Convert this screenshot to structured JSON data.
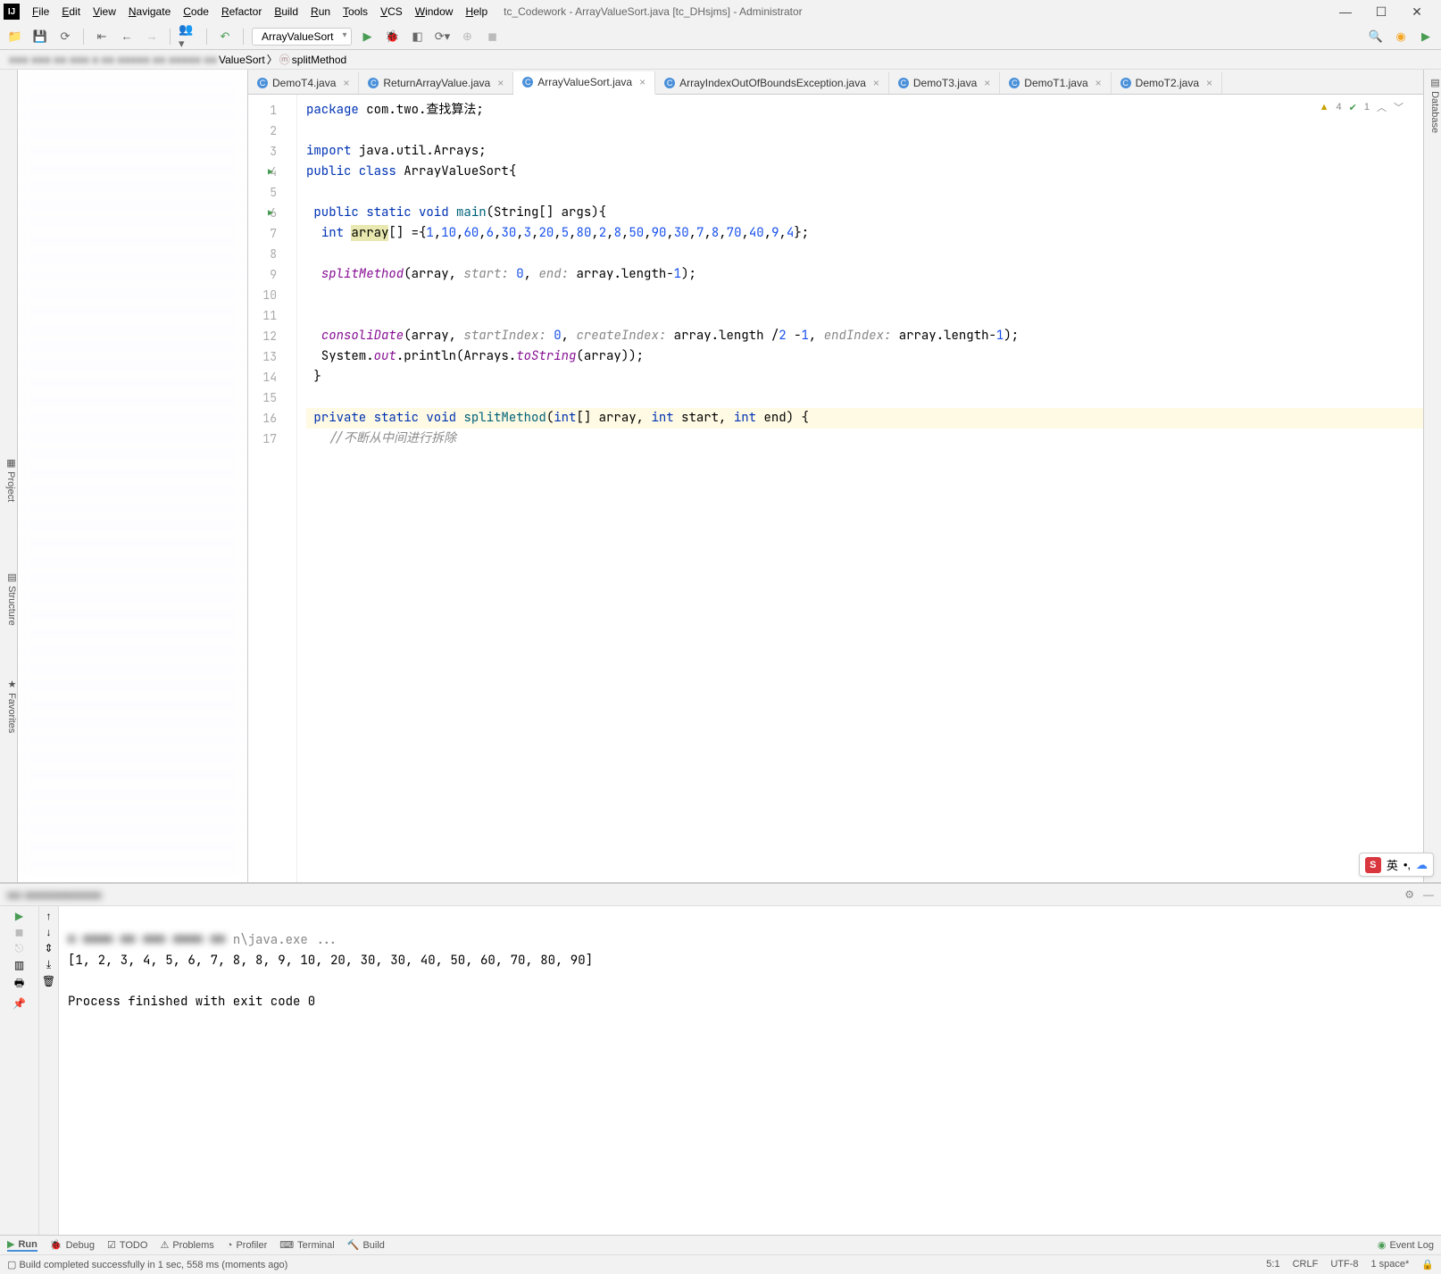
{
  "window_title": "tc_Codework - ArrayValueSort.java [tc_DHsjms] - Administrator",
  "menu": [
    "File",
    "Edit",
    "View",
    "Navigate",
    "Code",
    "Refactor",
    "Build",
    "Run",
    "Tools",
    "VCS",
    "Window",
    "Help"
  ],
  "run_config": "ArrayValueSort",
  "breadcrumb": {
    "tail": "ValueSort",
    "method": "splitMethod",
    "icon": "m"
  },
  "tabs": [
    {
      "label": "DemoT4.java"
    },
    {
      "label": "ReturnArrayValue.java"
    },
    {
      "label": "ArrayValueSort.java",
      "active": true
    },
    {
      "label": "ArrayIndexOutOfBoundsException.java"
    },
    {
      "label": "DemoT3.java"
    },
    {
      "label": "DemoT1.java"
    },
    {
      "label": "DemoT2.java"
    }
  ],
  "inspections": {
    "warn": "4",
    "ok": "1"
  },
  "code_lines": [
    {
      "n": 1,
      "html": "<span class='kw'>package</span> com.two.查找算法;"
    },
    {
      "n": 2,
      "html": ""
    },
    {
      "n": 3,
      "html": "<span class='kw'>import</span> java.util.Arrays;"
    },
    {
      "n": 4,
      "run": true,
      "html": "<span class='kw'>public class</span> <span class='cls'>ArrayValueSort</span>{"
    },
    {
      "n": 5,
      "html": ""
    },
    {
      "n": 6,
      "run": true,
      "html": " <span class='kw'>public static void</span> <span class='mthd'>main</span>(String[] args){"
    },
    {
      "n": 7,
      "html": "  <span class='kw'>int</span> <span class='hl'>array</span>[] ={<span class='num'>1</span>,<span class='num'>10</span>,<span class='num'>60</span>,<span class='num'>6</span>,<span class='num'>30</span>,<span class='num'>3</span>,<span class='num'>20</span>,<span class='num'>5</span>,<span class='num'>80</span>,<span class='num'>2</span>,<span class='num'>8</span>,<span class='num'>50</span>,<span class='num'>90</span>,<span class='num'>30</span>,<span class='num'>7</span>,<span class='num'>8</span>,<span class='num'>70</span>,<span class='num'>40</span>,<span class='num'>9</span>,<span class='num'>4</span>};"
    },
    {
      "n": 8,
      "html": ""
    },
    {
      "n": 9,
      "html": "  <span class='fld'>splitMethod</span>(array, <span class='param'>start:</span> <span class='num'>0</span>, <span class='param'>end:</span> array.length-<span class='num'>1</span>);"
    },
    {
      "n": 10,
      "html": ""
    },
    {
      "n": 11,
      "html": ""
    },
    {
      "n": 12,
      "html": "  <span class='fld'>consoliDate</span>(array, <span class='param'>startIndex:</span> <span class='num'>0</span>, <span class='param'>createIndex:</span> array.length /<span class='num'>2</span> -<span class='num'>1</span>, <span class='param'>endIndex:</span> array.length-<span class='num'>1</span>);"
    },
    {
      "n": 13,
      "html": "  System.<span class='fld'>out</span>.println(Arrays.<span class='fld'>toString</span>(array));"
    },
    {
      "n": 14,
      "html": " }"
    },
    {
      "n": 15,
      "html": ""
    },
    {
      "n": 16,
      "bulb": true,
      "html": " <span class='kw'>private static void</span> <span class='mthd'>splitMethod</span>(<span class='kw'>int</span>[] array, <span class='kw'>int</span> start, <span class='kw'>int</span> end) {"
    },
    {
      "n": 17,
      "html": "   <span class='cmt'>//不断从中间进行拆除</span>"
    }
  ],
  "console": {
    "cmd_suffix": "n\\java.exe ...",
    "output": "[1, 2, 3, 4, 5, 6, 7, 8, 8, 9, 10, 20, 30, 30, 40, 50, 60, 70, 80, 90]",
    "exit": "Process finished with exit code 0"
  },
  "bottom_tabs": [
    "Run",
    "Debug",
    "TODO",
    "Problems",
    "Profiler",
    "Terminal",
    "Build"
  ],
  "event_log": "Event Log",
  "status_msg": "Build completed successfully in 1 sec, 558 ms (moments ago)",
  "status_right": [
    "5:1",
    "CRLF",
    "UTF-8",
    "1 space*"
  ],
  "side": {
    "project": "Project",
    "database": "Database",
    "structure": "Structure",
    "favorites": "Favorites"
  },
  "ime": {
    "label": "英"
  }
}
